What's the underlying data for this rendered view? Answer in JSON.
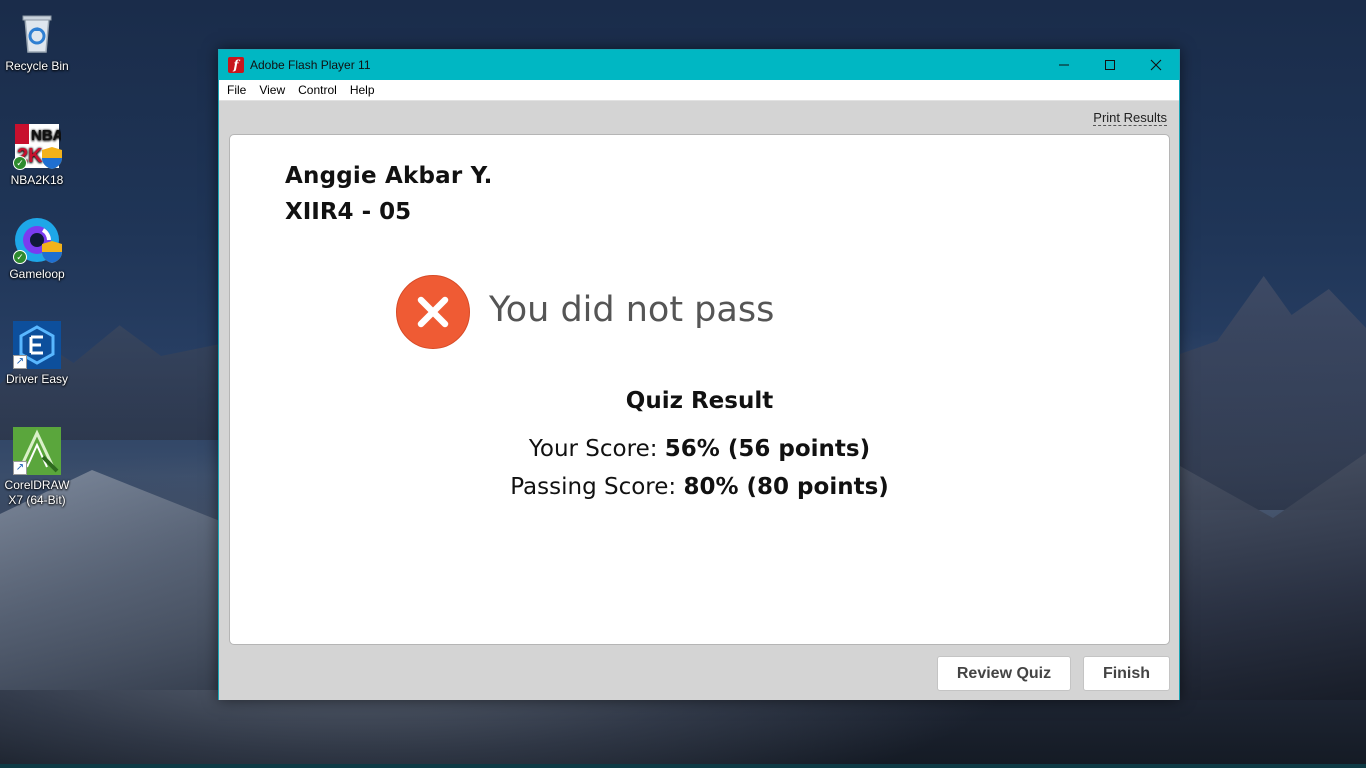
{
  "desktop": {
    "icons": [
      {
        "label": "Recycle Bin",
        "icon": "recycle-bin-icon"
      },
      {
        "label": "NBA2K18",
        "icon": "nba2k18-icon"
      },
      {
        "label": "Gameloop",
        "icon": "gameloop-icon"
      },
      {
        "label": "Driver Easy",
        "icon": "driver-easy-icon"
      },
      {
        "label": "CorelDRAW X7 (64-Bit)",
        "icon": "coreldraw-icon"
      }
    ]
  },
  "window": {
    "title": "Adobe Flash Player 11",
    "icon": "flash-icon",
    "controls": {
      "minimize": "—",
      "maximize": "☐",
      "close": "✕"
    },
    "accent": "#00b7c3"
  },
  "menu": [
    "File",
    "View",
    "Control",
    "Help"
  ],
  "quiz": {
    "print_label": "Print Results",
    "student_name": "Anggie Akbar Y.",
    "student_class": "XIIR4 - 05",
    "status_text": "You did not pass",
    "status_color": "#ef5b34",
    "result_title": "Quiz Result",
    "your_score_label": "Your Score:",
    "your_score_value": "56% (56 points)",
    "passing_score_label": "Passing Score:",
    "passing_score_value": "80% (80 points)",
    "review_button": "Review Quiz",
    "finish_button": "Finish"
  }
}
